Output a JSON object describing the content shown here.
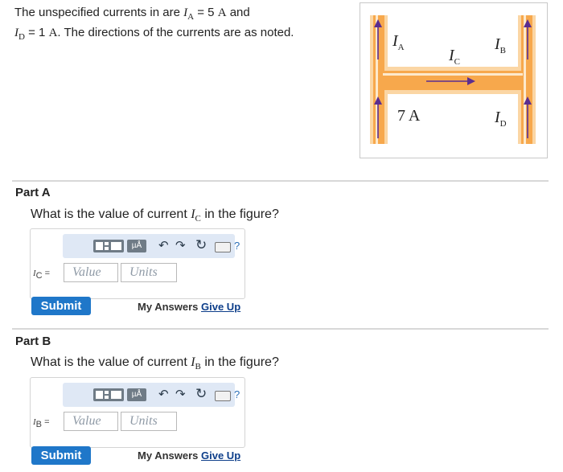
{
  "intro": {
    "line1_text": "The unspecified currents in are",
    "ia_symbol": "I",
    "ia_sub": "A",
    "line1_mid": "= 5",
    "ia_unit": "A",
    "line1_end": "and",
    "id_symbol": "I",
    "id_sub": "D",
    "line2_mid": "= 1",
    "id_unit": "A",
    "line2_end": ". The directions of the currents are as noted."
  },
  "figure": {
    "label_ia": "I",
    "label_ia_sub": "A",
    "label_ic": "I",
    "label_ic_sub": "C",
    "label_ib": "I",
    "label_ib_sub": "B",
    "label_7a": "7 A",
    "label_id": "I",
    "label_id_sub": "D"
  },
  "parts": [
    {
      "title": "Part A",
      "question_start": "What is the value of current",
      "var": "I",
      "var_sub": "C",
      "question_end": "in the figure?",
      "input_label": "I",
      "input_label_sub": "C",
      "input_label_eq": " =",
      "value_placeholder": "Value",
      "units_placeholder": "Units",
      "toolbar_mu": "µÅ",
      "toolbar_help": "?",
      "submit": "Submit",
      "my_answers": "My Answers",
      "give_up": "Give Up"
    },
    {
      "title": "Part B",
      "question_start": "What is the value of current",
      "var": "I",
      "var_sub": "B",
      "question_end": "in the figure?",
      "input_label": "I",
      "input_label_sub": "B",
      "input_label_eq": " =",
      "value_placeholder": "Value",
      "units_placeholder": "Units",
      "toolbar_mu": "µÅ",
      "toolbar_help": "?",
      "submit": "Submit",
      "my_answers": "My Answers",
      "give_up": "Give Up"
    }
  ],
  "icons": [
    "templates-icon",
    "units-icon",
    "undo-icon",
    "redo-icon",
    "reset-icon",
    "keyboard-icon",
    "help-icon"
  ],
  "colors": {
    "wire": "#f7a84c",
    "wire_glow": "#fbd6a4",
    "arrow": "#5b2d8f",
    "submit": "#1f77c9",
    "toolbar": "#dfe8f5"
  }
}
